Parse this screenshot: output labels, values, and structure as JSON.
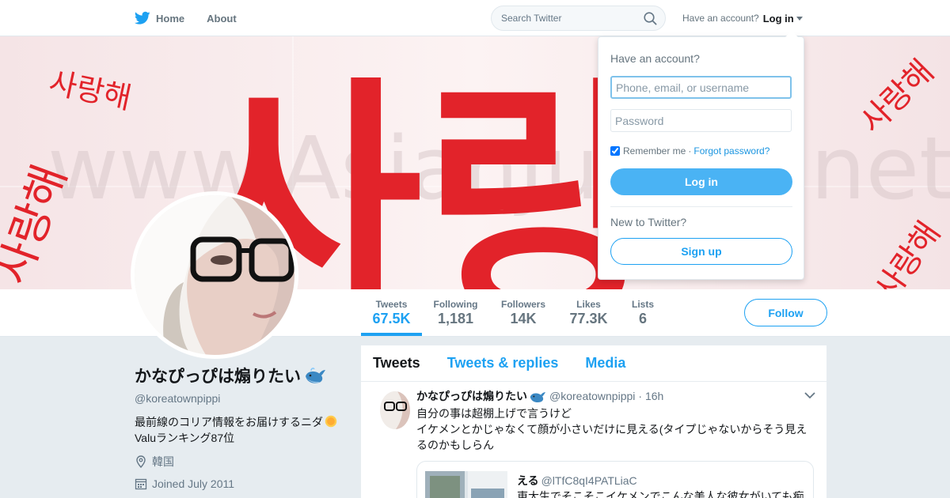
{
  "colors": {
    "accent": "#1da1f2",
    "banner_red": "#e2232a",
    "login_button": "#4ab3f4"
  },
  "topbar": {
    "home_label": "Home",
    "about_label": "About",
    "search_placeholder": "Search Twitter",
    "have_account_label": "Have an account?",
    "login_label": "Log in",
    "icons": [
      "twitter-bird-icon",
      "search-icon",
      "caret-down-icon"
    ]
  },
  "banner": {
    "big_text": "사랑",
    "small_text": "사랑해",
    "watermark": "www.AsianJunkie.net"
  },
  "stats": [
    {
      "label": "Tweets",
      "value": "67.5K"
    },
    {
      "label": "Following",
      "value": "1,181"
    },
    {
      "label": "Followers",
      "value": "14K"
    },
    {
      "label": "Likes",
      "value": "77.3K"
    },
    {
      "label": "Lists",
      "value": "6"
    }
  ],
  "follow_label": "Follow",
  "profile": {
    "name": "かなぴっぴは煽りたい",
    "handle": "@koreatownpippi",
    "bio_line1": "最前線のコリア情報をお届けするニダ",
    "bio_line2": "Valuランキング87位",
    "location": "韓国",
    "joined": "Joined July 2011"
  },
  "tabs": [
    "Tweets",
    "Tweets & replies",
    "Media"
  ],
  "tweet": {
    "name": "かなぴっぴは煽りたい",
    "handle": "@koreatownpippi",
    "time": "· 16h",
    "line1": "自分の事は超棚上げで言うけど",
    "line2": "イケメンとかじゃなくて顔が小さいだけに見える(タイプじゃないからそう見え",
    "line3": "るのかもしらん",
    "quote": {
      "name": "える",
      "handle": "@lTfC8qI4PATLiaC",
      "text": "東大生でそこそこイケメンでこんな美人な彼女がいても痴"
    }
  },
  "login_dropdown": {
    "title": "Have an account?",
    "username_placeholder": "Phone, email, or username",
    "password_placeholder": "Password",
    "remember_label": "Remember me",
    "separator": "·",
    "forgot_label": "Forgot password?",
    "login_button": "Log in",
    "new_label": "New to Twitter?",
    "signup_button": "Sign up"
  }
}
